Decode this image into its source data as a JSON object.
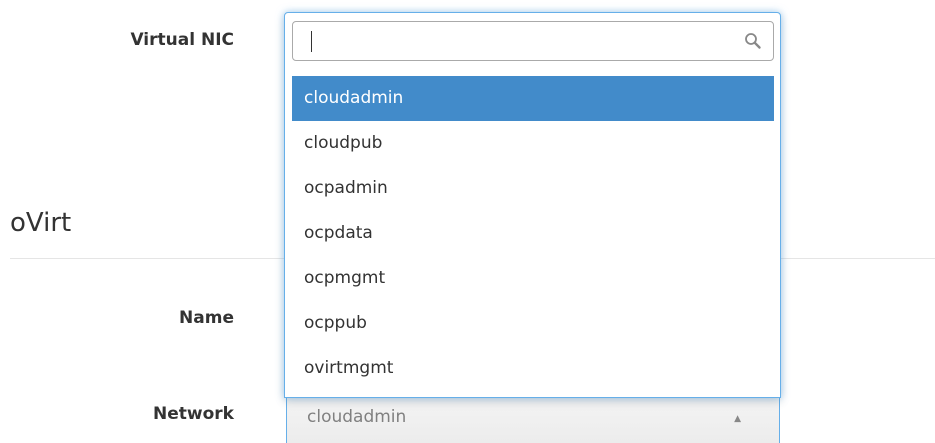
{
  "form": {
    "virtual_nic_label": "Virtual NIC",
    "name_label": "Name",
    "network_label": "Network"
  },
  "section": {
    "title": "oVirt"
  },
  "dropdown": {
    "search_value": "",
    "options": [
      {
        "label": "cloudadmin",
        "selected": true
      },
      {
        "label": "cloudpub",
        "selected": false
      },
      {
        "label": "ocpadmin",
        "selected": false
      },
      {
        "label": "ocpdata",
        "selected": false
      },
      {
        "label": "ocpmgmt",
        "selected": false
      },
      {
        "label": "ocppub",
        "selected": false
      },
      {
        "label": "ovirtmgmt",
        "selected": false
      }
    ],
    "highlight_color": "#428bca"
  },
  "network_select": {
    "value": "cloudadmin",
    "arrow": "▲"
  },
  "icons": {
    "search": "search-icon",
    "select_arrow": "caret-up-icon"
  }
}
